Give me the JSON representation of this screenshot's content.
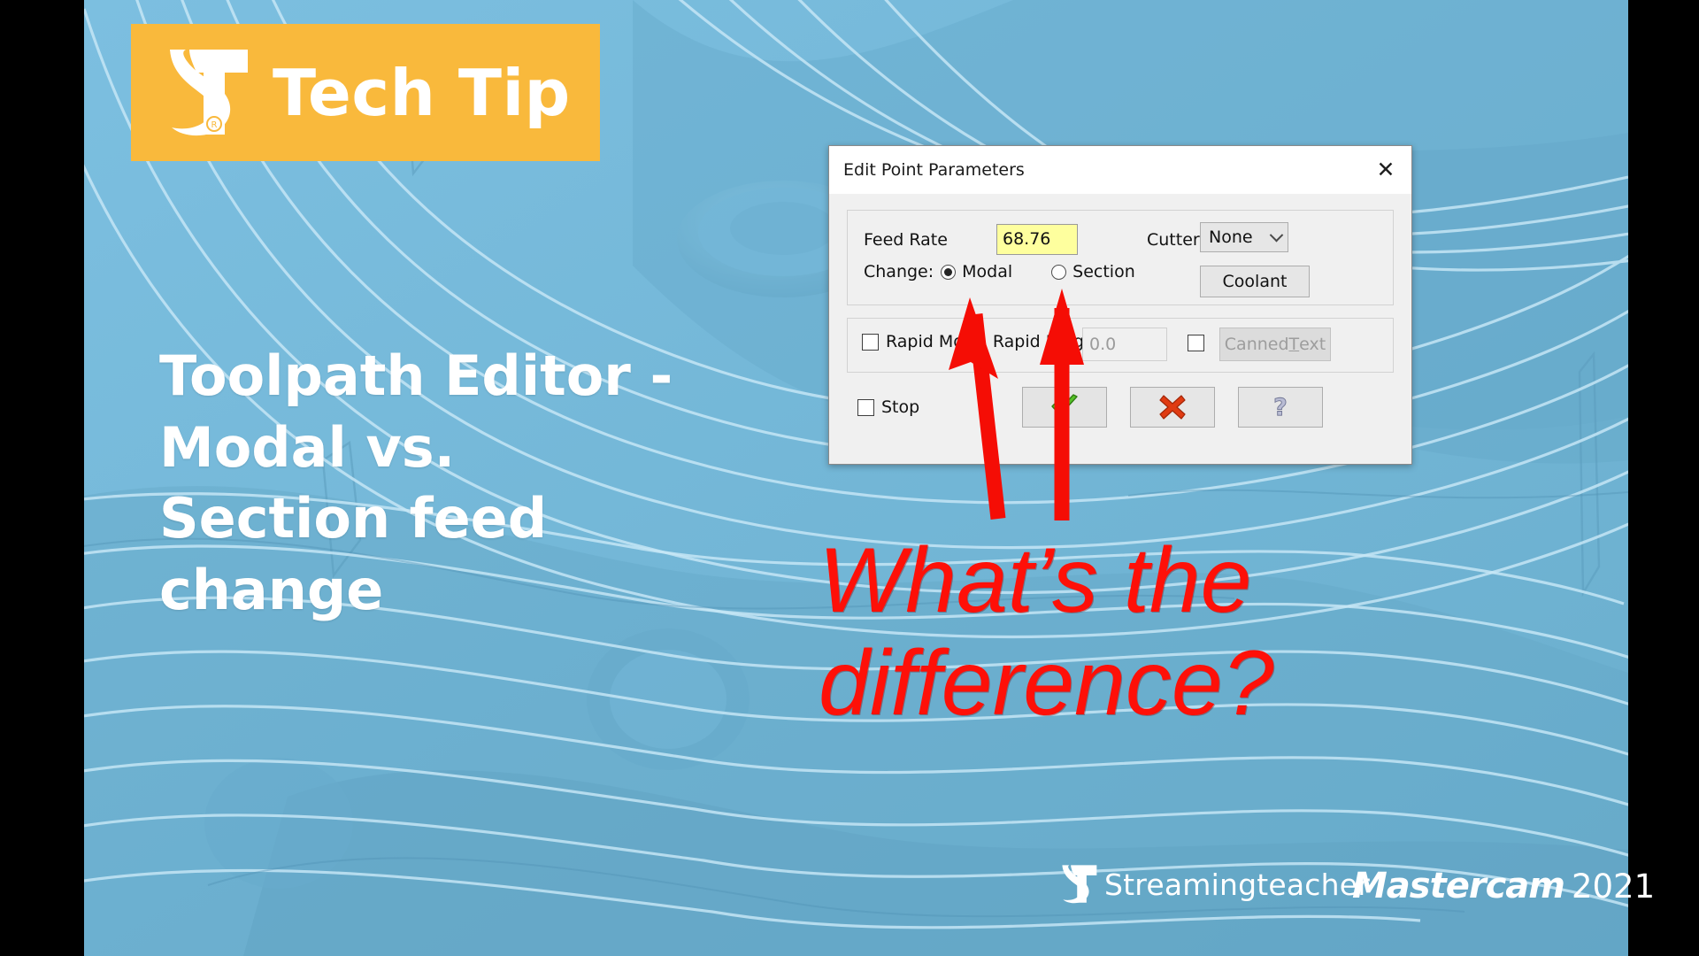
{
  "branding": {
    "tech_tip_label": "Tech Tip",
    "logo_icon": "streamingteacher-st-logo-icon",
    "footer_name": "Streamingteacher",
    "mastercam_name": "Mastercam",
    "mastercam_year": "2021",
    "accent_orange": "#f9b93c",
    "background_blue": "#74b7dc"
  },
  "headline": {
    "line1": "Toolpath Editor -",
    "line2": "Modal vs.",
    "line3": "Section feed",
    "line4": "change",
    "color": "#ffffff"
  },
  "annotation": {
    "question_line1": "What’s the",
    "question_line2": "difference?",
    "color": "#fe1008",
    "arrows": [
      {
        "name": "arrow-to-modal-radio",
        "points_at": "Modal"
      },
      {
        "name": "arrow-to-section-radio",
        "points_at": "Section"
      }
    ]
  },
  "dialog": {
    "title": "Edit Point Parameters",
    "close_icon": "close-x-icon",
    "feed": {
      "feed_rate_label": "Feed Rate",
      "feed_rate_value": "68.76",
      "feed_rate_highlight": "#feff9e",
      "change_label": "Change:",
      "modal_label": "Modal",
      "section_label": "Section",
      "modal_selected": true,
      "section_selected": false,
      "cutter_comp_label": "Cutter Comp",
      "cutter_comp_value": "None",
      "cutter_comp_chevron": "chevron-down-icon",
      "coolant_label": "Coolant"
    },
    "rapid": {
      "rapid_move_label": "Rapid Move",
      "rapid_move_checked": false,
      "rapid_height_label": "Rapid Height",
      "rapid_height_value": "0.0",
      "canned_text_checked": false,
      "canned_text_label_pre": "Canned ",
      "canned_text_label_accel": "T",
      "canned_text_label_post": "ext"
    },
    "footer": {
      "stop_label": "Stop",
      "stop_checked": false,
      "ok_icon": "green-check-icon",
      "cancel_icon": "red-x-icon",
      "help_icon": "question-mark-icon"
    }
  }
}
